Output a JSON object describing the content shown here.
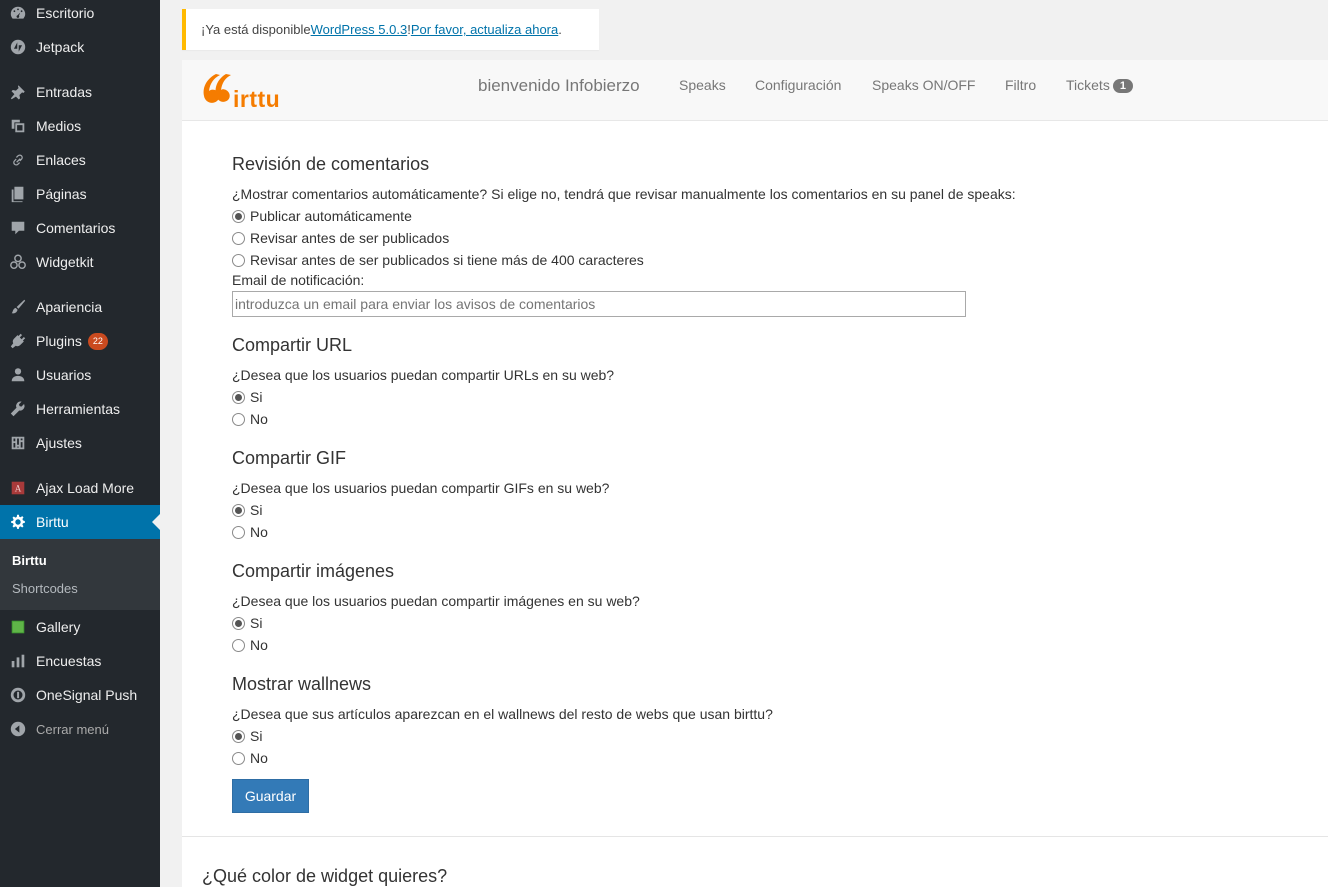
{
  "sidebar": {
    "items": [
      {
        "label": "Escritorio",
        "icon": "dashboard-icon"
      },
      {
        "label": "Jetpack",
        "icon": "jetpack-icon"
      },
      {
        "label": "Entradas",
        "icon": "pin-icon"
      },
      {
        "label": "Medios",
        "icon": "media-icon"
      },
      {
        "label": "Enlaces",
        "icon": "link-icon"
      },
      {
        "label": "Páginas",
        "icon": "pages-icon"
      },
      {
        "label": "Comentarios",
        "icon": "comment-icon"
      },
      {
        "label": "Widgetkit",
        "icon": "widgetkit-icon"
      },
      {
        "label": "Apariencia",
        "icon": "brush-icon"
      },
      {
        "label": "Plugins",
        "icon": "plugin-icon",
        "badge": "22"
      },
      {
        "label": "Usuarios",
        "icon": "user-icon"
      },
      {
        "label": "Herramientas",
        "icon": "wrench-icon"
      },
      {
        "label": "Ajustes",
        "icon": "settings-sliders-icon"
      },
      {
        "label": "Ajax Load More",
        "icon": "ajax-load-more-icon"
      },
      {
        "label": "Birttu",
        "icon": "gear-icon"
      },
      {
        "label": "Gallery",
        "icon": "gallery-icon"
      },
      {
        "label": "Encuestas",
        "icon": "bar-chart-icon"
      },
      {
        "label": "OneSignal Push",
        "icon": "onesignal-icon"
      },
      {
        "label": "Cerrar menú",
        "icon": "collapse-arrow-icon"
      }
    ],
    "submenu": [
      "Birttu",
      "Shortcodes"
    ]
  },
  "notice": {
    "prefix": "¡Ya está disponible ",
    "link1": "WordPress 5.0.3",
    "middle": "! ",
    "link2": "Por favor, actualiza ahora",
    "suffix": "."
  },
  "topnav": {
    "brand": "bienvenido Infobierzo",
    "logo_text": "irttu",
    "links": [
      "Speaks",
      "Configuración",
      "Speaks ON/OFF",
      "Filtro",
      "Tickets"
    ],
    "tickets_badge": "1"
  },
  "sections": {
    "review": {
      "title": "Revisión de comentarios",
      "question": "¿Mostrar comentarios automáticamente? Si elige no, tendrá que revisar manualmente los comentarios en su panel de speaks:",
      "options": [
        "Publicar automáticamente",
        "Revisar antes de ser publicados",
        "Revisar antes de ser publicados si tiene más de 400 caracteres"
      ],
      "selected": 0,
      "email_label": "Email de notificación:",
      "email_placeholder": "introduzca un email para enviar los avisos de comentarios"
    },
    "url": {
      "title": "Compartir URL",
      "question": "¿Desea que los usuarios puedan compartir URLs en su web?",
      "options": [
        "Si",
        "No"
      ],
      "selected": 0
    },
    "gif": {
      "title": "Compartir GIF",
      "question": "¿Desea que los usuarios puedan compartir GIFs en su web?",
      "options": [
        "Si",
        "No"
      ],
      "selected": 0
    },
    "images": {
      "title": "Compartir imágenes",
      "question": "¿Desea que los usuarios puedan compartir imágenes en su web?",
      "options": [
        "Si",
        "No"
      ],
      "selected": 0
    },
    "wallnews": {
      "title": "Mostrar wallnews",
      "question": "¿Desea que sus artículos aparezcan en el wallnews del resto de webs que usan birttu?",
      "options": [
        "Si",
        "No"
      ],
      "selected": 0
    }
  },
  "save_label": "Guardar",
  "widget_title": "¿Qué color de widget quieres?",
  "colors": {
    "sidebar_bg": "#23282d",
    "active": "#0073aa",
    "button": "#337ab7",
    "brand_orange": "#f57c00",
    "notice_border": "#ffb900"
  }
}
